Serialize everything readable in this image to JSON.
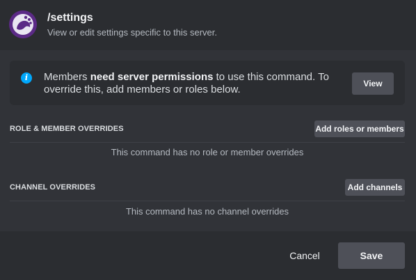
{
  "header": {
    "title": "/settings",
    "subtitle": "View or edit settings specific to this server.",
    "avatar_icon": "bot-avatar-icon"
  },
  "notice": {
    "icon": "info-icon",
    "icon_glyph": "i",
    "text_prefix": "Members ",
    "text_bold": "need server permissions",
    "text_suffix": " to use this command. To override this, add members or roles below.",
    "view_label": "View"
  },
  "role_overrides": {
    "title": "ROLE & MEMBER OVERRIDES",
    "add_label": "Add roles or members",
    "empty_text": "This command has no role or member overrides"
  },
  "channel_overrides": {
    "title": "CHANNEL OVERRIDES",
    "add_label": "Add channels",
    "empty_text": "This command has no channel overrides"
  },
  "footer": {
    "cancel_label": "Cancel",
    "save_label": "Save"
  },
  "colors": {
    "accent_info": "#00a8fc",
    "button_bg": "#4e5058",
    "panel_bg": "#2b2d31",
    "body_bg": "#313338"
  }
}
